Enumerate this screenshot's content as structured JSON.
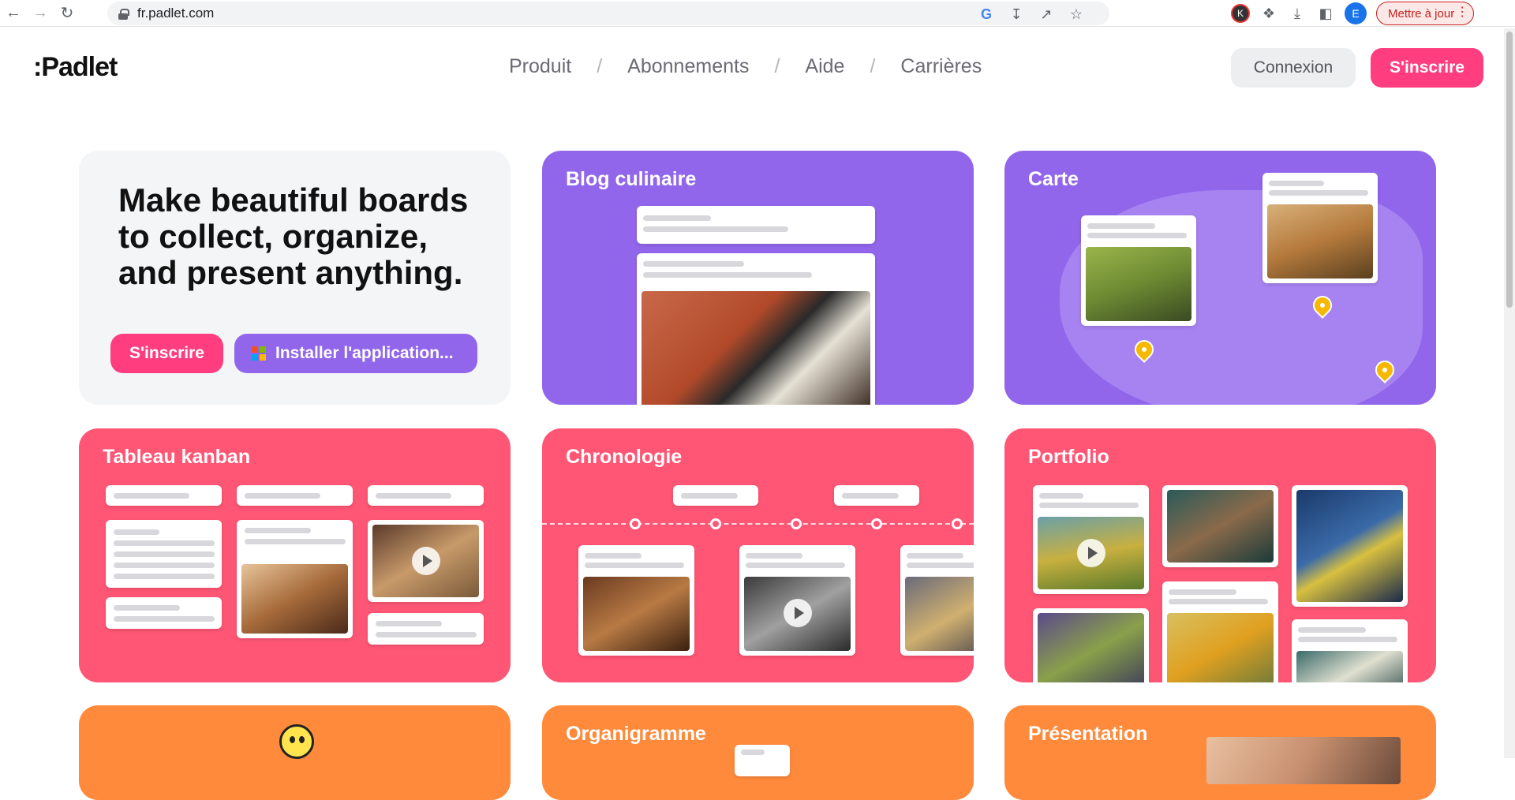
{
  "browser": {
    "url": "fr.padlet.com",
    "update_label": "Mettre à jour",
    "avatar_k": "K",
    "avatar_e": "E"
  },
  "header": {
    "logo": ":Padlet",
    "nav": [
      "Produit",
      "Abonnements",
      "Aide",
      "Carrières"
    ],
    "separator": "/",
    "login_label": "Connexion",
    "signup_label": "S'inscrire"
  },
  "hero": {
    "headline": "Make beautiful boards to collect, organize, and present anything.",
    "signup_label": "S'inscrire",
    "install_label": "Installer l'application..."
  },
  "cards": {
    "blog": "Blog culinaire",
    "map": "Carte",
    "kanban": "Tableau kanban",
    "timeline": "Chronologie",
    "portfolio": "Portfolio",
    "orgchart": "Organigramme",
    "presentation": "Présentation"
  },
  "colors": {
    "brand_pink": "#ff3d7f",
    "purple": "#9166eb",
    "pink": "#ff5675",
    "orange": "#ff8a3c"
  }
}
